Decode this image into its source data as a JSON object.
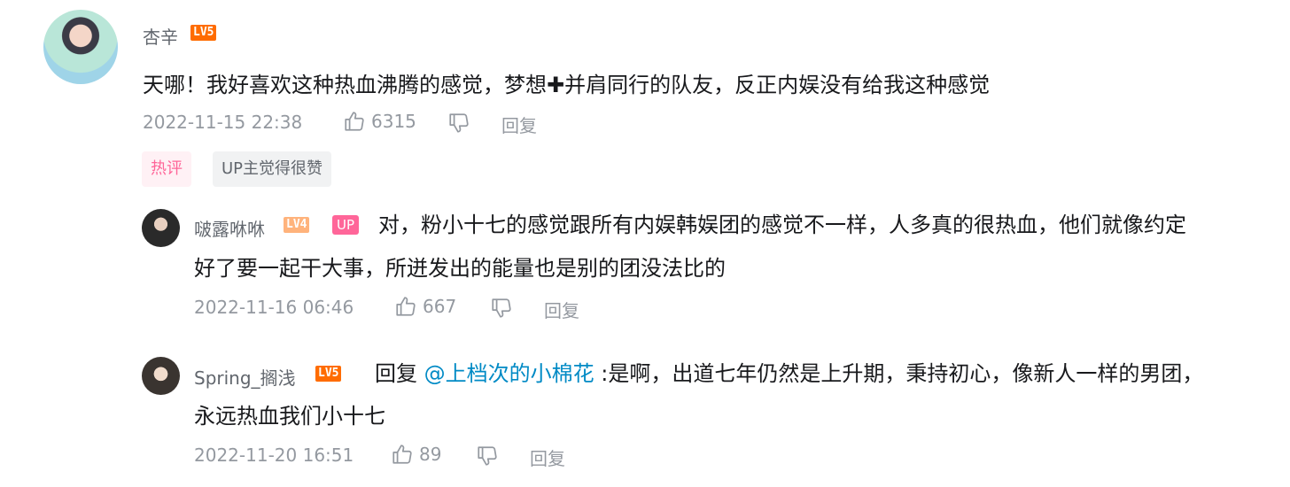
{
  "comment": {
    "username": "杏辛",
    "level": "LV5",
    "text": "天哪！我好喜欢这种热血沸腾的感觉，梦想✚并肩同行的队友，反正内娱没有给我这种感觉",
    "time": "2022-11-15 22:38",
    "likes": "6315",
    "reply_label": "回复",
    "tags": {
      "hot": "热评",
      "up_liked": "UP主觉得很赞"
    }
  },
  "replies": [
    {
      "username": "啵露咻咻",
      "level": "LV4",
      "up_badge": "UP",
      "text_line1": "对，粉小十七的感觉跟所有内娱韩娱团的感觉不一样，人多真的很热血，他们就像约定",
      "text_line2": "好了要一起干大事，所迸发出的能量也是别的团没法比的",
      "time": "2022-11-16 06:46",
      "likes": "667",
      "reply_label": "回复"
    },
    {
      "username": "Spring_搁浅",
      "level": "LV5",
      "reply_prefix": "回复",
      "mention": "@上档次的小棉花",
      "text_line1": " :是啊，出道七年仍然是上升期，秉持初心，像新人一样的男团，",
      "text_line2": "永远热血我们小十七",
      "time": "2022-11-20 16:51",
      "likes": "89",
      "reply_label": "回复"
    }
  ],
  "colors": {
    "level5": "#ff6c00",
    "level4": "#ffb37c",
    "up_badge": "#ff6699",
    "mention": "#008ac5",
    "meta_text": "#9499a0"
  },
  "icons": [
    "like-icon",
    "dislike-icon"
  ]
}
